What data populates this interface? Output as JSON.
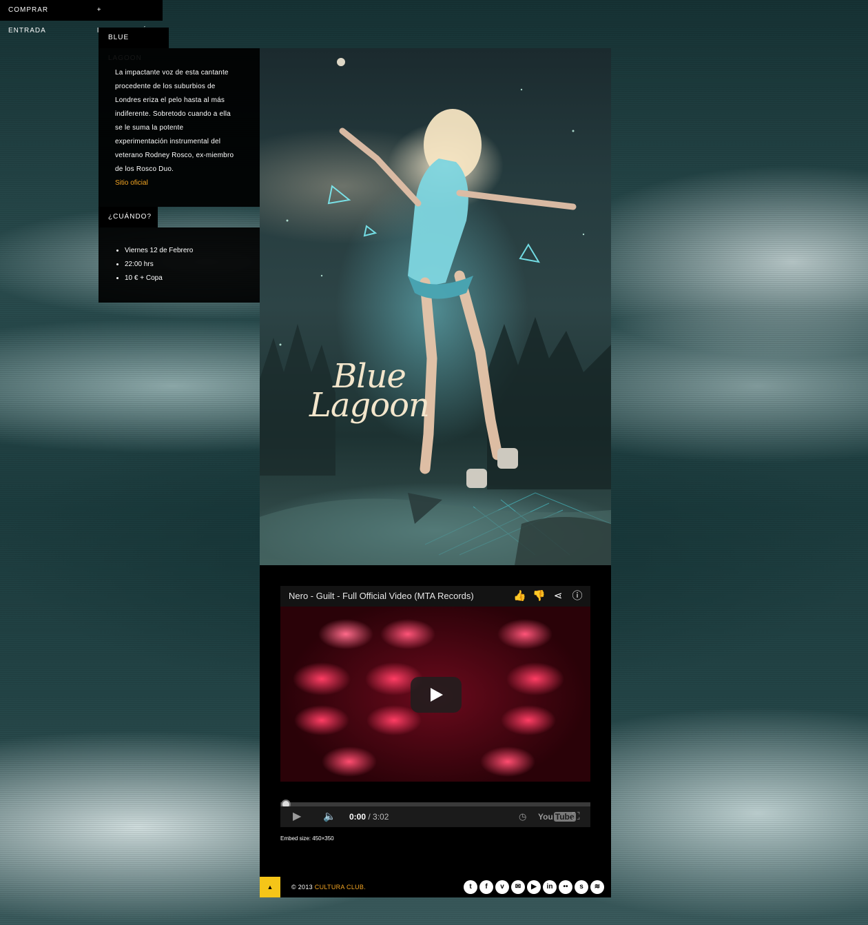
{
  "header": {
    "site_tab": "BLUE LAGOON",
    "nav": [
      "COMPRAR ENTRADA",
      "+ INFORMACIÓN"
    ]
  },
  "about": {
    "lines": [
      "La impactante voz de esta cantante",
      "procedente de los suburbios de",
      "Londres eriza el pelo hasta al más",
      "indiferente. Sobretodo cuando a ella",
      "se le suma la potente",
      "experimentación instrumental del",
      "veterano Rodney Rosco, ex-miembro",
      "de los Rosco Duo."
    ],
    "link": "Sitio oficial"
  },
  "when": {
    "tab": "¿CUÁNDO?",
    "items": [
      "Viernes 12 de Febrero",
      "22:00 hrs",
      "10 € + Copa"
    ]
  },
  "poster": {
    "title_line1": "Blue",
    "title_line2": "Lagoon"
  },
  "video": {
    "title": "Nero - Guilt - Full Official Video (MTA Records)",
    "actions": [
      "thumbs-up-icon",
      "thumbs-down-icon",
      "share-icon",
      "info-icon"
    ],
    "current_time": "0:00",
    "duration": " / 3:02",
    "progress": 0,
    "logo_a": "You",
    "logo_b": "Tube",
    "embed_note": "Embed size: 450×350"
  },
  "footer": {
    "top_arrow": "▲",
    "copyright_prefix": "© 2013",
    "brand": "CULTURA CLUB.",
    "social": [
      "twitter",
      "facebook",
      "vimeo",
      "email",
      "youtube",
      "linkedin",
      "flickr",
      "skype",
      "rss"
    ],
    "social_glyphs": [
      "t",
      "f",
      "v",
      "✉",
      "▶",
      "in",
      "••",
      "s",
      "≋"
    ]
  },
  "colors": {
    "accent": "#f5a623",
    "top_button": "#f5c518",
    "panel": "#000000"
  }
}
